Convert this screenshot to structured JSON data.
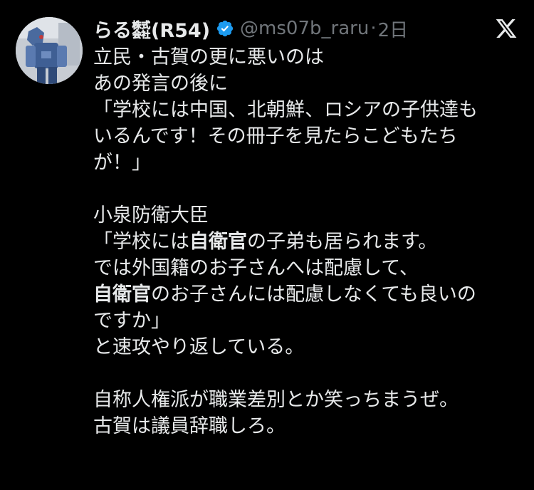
{
  "tweet": {
    "display_name": "らる㍿(R54)",
    "handle": "@ms07b_raru",
    "separator": "·",
    "time": "2日",
    "lines": {
      "l1": "立民・古賀の更に悪いのは",
      "l2": "あの発言の後に",
      "l3": "「学校には中国、北朝鮮、ロシアの子供達も",
      "l4": "いるんです！その冊子を見たらこどもたち",
      "l5": "が！」",
      "l6": "小泉防衛大臣",
      "l7a": "「学校には",
      "l7b": "自衛官",
      "l7c": "の子弟も居られます。",
      "l8": "では外国籍のお子さんへは配慮して、",
      "l9a": "自衛官",
      "l9b": "のお子さんには配慮しなくても良いの",
      "l10": "ですか」",
      "l11": "と速攻やり返している。",
      "l12": "自称人権派が職業差別とか笑っちまうぜ。",
      "l13": "古賀は議員辞職しろ。"
    }
  },
  "icons": {
    "avatar": "user-avatar",
    "verified": "verified-badge-icon",
    "platform": "x-logo-icon"
  },
  "colors": {
    "background": "#000000",
    "text": "#e7e9ea",
    "muted": "#71767b",
    "verified": "#1d9bf0"
  }
}
